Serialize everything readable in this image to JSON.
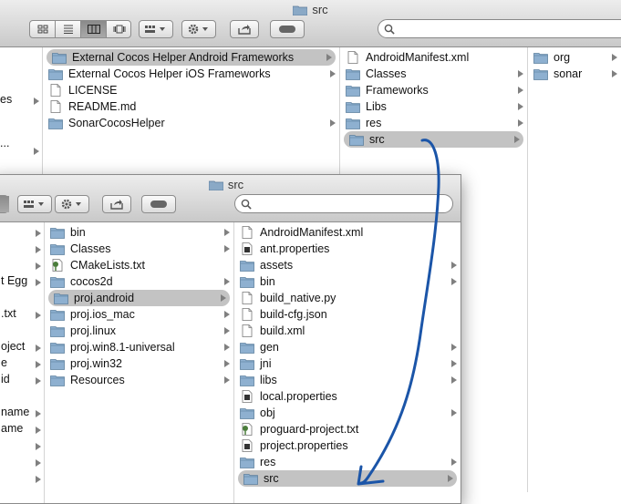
{
  "back_window": {
    "title": "src",
    "col0_fragments": [
      "es",
      "..."
    ],
    "col1": [
      {
        "label": "External Cocos Helper Android Frameworks",
        "kind": "folder",
        "selected": true,
        "arrow": true
      },
      {
        "label": "External Cocos Helper iOS Frameworks",
        "kind": "folder",
        "arrow": true
      },
      {
        "label": "LICENSE",
        "kind": "file"
      },
      {
        "label": "README.md",
        "kind": "file"
      },
      {
        "label": "SonarCocosHelper",
        "kind": "folder",
        "arrow": true
      }
    ],
    "col2": [
      {
        "label": "AndroidManifest.xml",
        "kind": "file"
      },
      {
        "label": "Classes",
        "kind": "folder",
        "arrow": true
      },
      {
        "label": "Frameworks",
        "kind": "folder",
        "arrow": true
      },
      {
        "label": "Libs",
        "kind": "folder",
        "arrow": true
      },
      {
        "label": "res",
        "kind": "folder",
        "arrow": true
      },
      {
        "label": "src",
        "kind": "folder",
        "selected": true,
        "arrow": true
      }
    ],
    "col3": [
      {
        "label": "org",
        "kind": "folder",
        "arrow": true
      },
      {
        "label": "sonar",
        "kind": "folder",
        "arrow": true
      }
    ]
  },
  "front_window": {
    "title": "src",
    "col0_fragments": [
      "t Egg",
      ".txt",
      "oject",
      "e",
      "id",
      "name",
      "ame"
    ],
    "col1": [
      {
        "label": "bin",
        "kind": "folder",
        "arrow": true
      },
      {
        "label": "Classes",
        "kind": "folder",
        "arrow": true
      },
      {
        "label": "CMakeLists.txt",
        "kind": "cmake"
      },
      {
        "label": "cocos2d",
        "kind": "folder",
        "arrow": true
      },
      {
        "label": "proj.android",
        "kind": "folder",
        "selected": true,
        "arrow": true
      },
      {
        "label": "proj.ios_mac",
        "kind": "folder",
        "arrow": true
      },
      {
        "label": "proj.linux",
        "kind": "folder",
        "arrow": true
      },
      {
        "label": "proj.win8.1-universal",
        "kind": "folder",
        "arrow": true
      },
      {
        "label": "proj.win32",
        "kind": "folder",
        "arrow": true
      },
      {
        "label": "Resources",
        "kind": "folder",
        "arrow": true
      }
    ],
    "col2": [
      {
        "label": "AndroidManifest.xml",
        "kind": "file"
      },
      {
        "label": "ant.properties",
        "kind": "props"
      },
      {
        "label": "assets",
        "kind": "folder",
        "arrow": true
      },
      {
        "label": "bin",
        "kind": "folder",
        "arrow": true
      },
      {
        "label": "build_native.py",
        "kind": "file"
      },
      {
        "label": "build-cfg.json",
        "kind": "file"
      },
      {
        "label": "build.xml",
        "kind": "file"
      },
      {
        "label": "gen",
        "kind": "folder",
        "arrow": true
      },
      {
        "label": "jni",
        "kind": "folder",
        "arrow": true
      },
      {
        "label": "libs",
        "kind": "folder",
        "arrow": true
      },
      {
        "label": "local.properties",
        "kind": "props"
      },
      {
        "label": "obj",
        "kind": "folder",
        "arrow": true
      },
      {
        "label": "proguard-project.txt",
        "kind": "cmake"
      },
      {
        "label": "project.properties",
        "kind": "props"
      },
      {
        "label": "res",
        "kind": "folder",
        "arrow": true
      },
      {
        "label": "src",
        "kind": "folder",
        "selected": true,
        "arrow": true
      }
    ]
  },
  "search_placeholder": "",
  "colors": {
    "annotation": "#1b55a8",
    "selection": "#c3c3c3",
    "folder": "#6f94b8"
  }
}
